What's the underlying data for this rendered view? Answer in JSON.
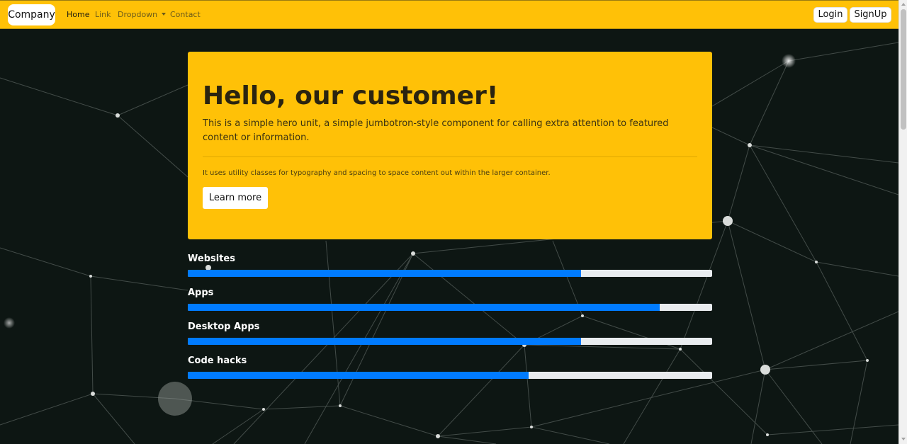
{
  "navbar": {
    "brand": "Company",
    "links": [
      {
        "label": "Home",
        "active": true
      },
      {
        "label": "Link",
        "active": false
      },
      {
        "label": "Dropdown",
        "active": false
      },
      {
        "label": "Contact",
        "active": false
      }
    ],
    "login_label": "Login",
    "signup_label": "SignUp"
  },
  "hero": {
    "title": "Hello, our customer!",
    "lead": "This is a simple hero unit, a simple jumbotron-style component for calling extra attention to featured content or information.",
    "note": "It uses utility classes for typography and spacing to space content out within the larger container.",
    "button_label": "Learn more"
  },
  "skills": [
    {
      "label": "Websites",
      "percent": 75
    },
    {
      "label": "Apps",
      "percent": 90
    },
    {
      "label": "Desktop Apps",
      "percent": 75
    },
    {
      "label": "Code hacks",
      "percent": 65
    }
  ],
  "colors": {
    "navbar": "#ffc107",
    "jumbotron": "#ffc107",
    "progress_fill": "#007bff",
    "progress_track": "#e9ecef",
    "background": "#0d1613"
  }
}
